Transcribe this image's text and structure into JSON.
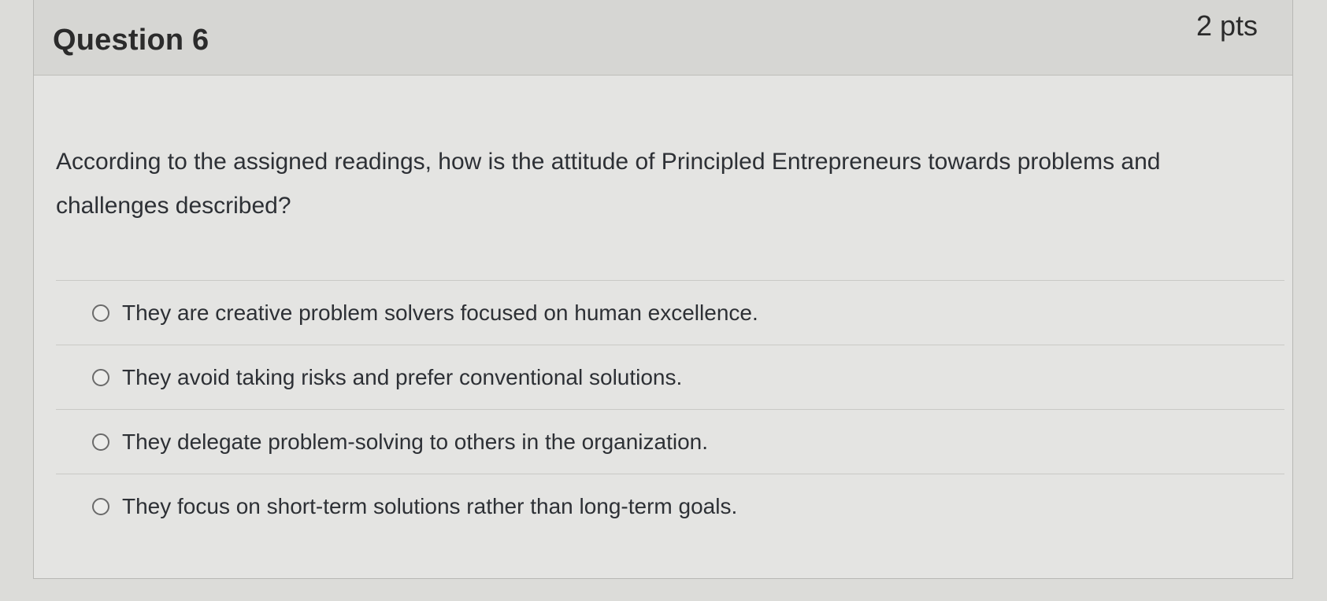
{
  "question": {
    "title": "Question 6",
    "points": "2 pts",
    "text": "According to the assigned readings, how is the attitude of Principled Entrepreneurs towards problems and challenges described?"
  },
  "answers": [
    {
      "label": "They are creative problem solvers focused on human excellence."
    },
    {
      "label": "They avoid taking risks and prefer conventional solutions."
    },
    {
      "label": "They delegate problem-solving to others in the organization."
    },
    {
      "label": "They focus on short-term solutions rather than long-term goals."
    }
  ],
  "colors": {
    "background": "#dcdcd9",
    "header": "#d6d6d3",
    "text": "#2d3035"
  }
}
